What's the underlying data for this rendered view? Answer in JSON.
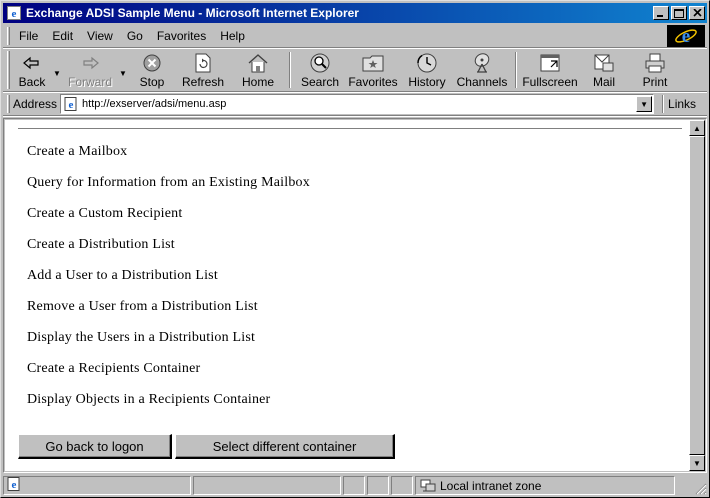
{
  "window": {
    "title": "Exchange ADSI Sample Menu - Microsoft Internet Explorer"
  },
  "menubar": {
    "items": [
      {
        "label": "File"
      },
      {
        "label": "Edit"
      },
      {
        "label": "View"
      },
      {
        "label": "Go"
      },
      {
        "label": "Favorites"
      },
      {
        "label": "Help"
      }
    ]
  },
  "toolbar": {
    "back": "Back",
    "forward": "Forward",
    "stop": "Stop",
    "refresh": "Refresh",
    "home": "Home",
    "search": "Search",
    "favorites": "Favorites",
    "history": "History",
    "channels": "Channels",
    "fullscreen": "Fullscreen",
    "mail": "Mail",
    "print": "Print"
  },
  "addressbar": {
    "label": "Address",
    "url": "http://exserver/adsi/menu.asp",
    "links": "Links"
  },
  "page": {
    "links": [
      "Create a Mailbox",
      "Query for Information from an Existing Mailbox",
      "Create a Custom Recipient",
      "Create a Distribution List",
      "Add a User to a Distribution List",
      "Remove a User from a Distribution List",
      "Display the Users in a Distribution List",
      "Create a Recipients Container",
      "Display Objects in a Recipients Container"
    ],
    "buttons": {
      "back_to_logon": "Go back to logon",
      "select_container": "Select different container"
    }
  },
  "statusbar": {
    "zone": "Local intranet zone"
  },
  "colors": {
    "titlebar_start": "#000080",
    "titlebar_end": "#1084d0",
    "chrome": "#c0c0c0"
  }
}
